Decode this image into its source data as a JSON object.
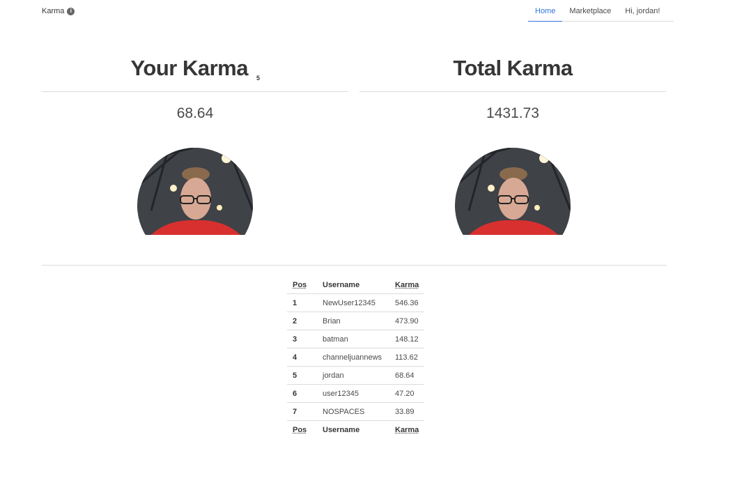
{
  "header": {
    "brand": "Karma",
    "brand_icon": "info-circle-icon",
    "nav": [
      "Home",
      "Marketplace",
      "Hi, jordan!"
    ],
    "active_nav": "Home"
  },
  "your_karma": {
    "title": "Your Karma",
    "rank": "5",
    "value": "68.64",
    "avatar": "profile-photo"
  },
  "total_karma": {
    "title": "Total Karma",
    "value": "1431.73",
    "avatar": "profile-photo"
  },
  "leaderboard": {
    "headers": [
      "Pos",
      "Username",
      "Karma"
    ],
    "rows": [
      {
        "pos": "1",
        "username": "NewUser12345",
        "karma": "546.36"
      },
      {
        "pos": "2",
        "username": "Brian",
        "karma": "473.90"
      },
      {
        "pos": "3",
        "username": "batman",
        "karma": "148.12"
      },
      {
        "pos": "4",
        "username": "channeljuannews",
        "karma": "113.62"
      },
      {
        "pos": "5",
        "username": "jordan",
        "karma": "68.64"
      },
      {
        "pos": "6",
        "username": "user12345",
        "karma": "47.20"
      },
      {
        "pos": "7",
        "username": "NOSPACES",
        "karma": "33.89"
      }
    ]
  },
  "colors": {
    "accent": "#3273dc",
    "text": "#363636",
    "border": "#dbdbdb"
  }
}
